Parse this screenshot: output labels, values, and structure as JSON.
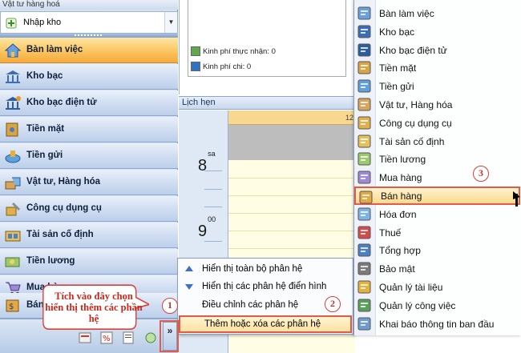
{
  "nav": {
    "section_title": "Vật tư hàng hoá",
    "combo_value": "Nhập kho",
    "items": [
      {
        "label": "Bàn làm việc",
        "icon": "home-icon",
        "selected": true
      },
      {
        "label": "Kho bạc",
        "icon": "bank-icon"
      },
      {
        "label": "Kho bạc điện tử",
        "icon": "e-treasury-icon"
      },
      {
        "label": "Tiền mặt",
        "icon": "cash-icon"
      },
      {
        "label": "Tiền gửi",
        "icon": "deposit-icon"
      },
      {
        "label": "Vật tư, Hàng hóa",
        "icon": "goods-icon"
      },
      {
        "label": "Công cụ dụng cụ",
        "icon": "tools-icon"
      },
      {
        "label": "Tài sản cố định",
        "icon": "fixed-asset-icon"
      },
      {
        "label": "Tiền lương",
        "icon": "salary-icon"
      },
      {
        "label": "Mua hàng",
        "icon": "cart-icon"
      },
      {
        "label": "Bán",
        "icon": "sales-icon"
      }
    ]
  },
  "panel": {
    "legend_received": "Kinh phí thực nhận: 0",
    "legend_spent": "Kinh phí chi: 0",
    "colors": {
      "received": "#5fa84a",
      "spent": "#2f72c4"
    }
  },
  "calendar": {
    "title": "Lịch hẹn",
    "day_header": "12",
    "hour_8": "8",
    "hour_8_suffix": "sa",
    "hour_9": "9",
    "hour_9_suffix": "00"
  },
  "context_menu": {
    "items": [
      {
        "label": "Hiển thị toàn bộ phân hệ",
        "icon": "arrow-up-icon"
      },
      {
        "label": "Hiển thị các phân hệ điển hình",
        "icon": "arrow-down-icon"
      },
      {
        "label": "Điều chỉnh các phân hệ",
        "icon": "none"
      },
      {
        "label": "Thêm hoặc xóa các phân hệ",
        "icon": "none",
        "highlighted": true
      }
    ]
  },
  "module_menu": {
    "items": [
      {
        "label": "Bàn làm việc",
        "icon": "home-icon"
      },
      {
        "label": "Kho bạc",
        "icon": "bank-icon"
      },
      {
        "label": "Kho bạc điện tử",
        "icon": "e-treasury-icon"
      },
      {
        "label": "Tiền mặt",
        "icon": "cash-icon"
      },
      {
        "label": "Tiền gửi",
        "icon": "deposit-icon"
      },
      {
        "label": "Vật tư, Hàng hóa",
        "icon": "goods-icon"
      },
      {
        "label": "Công cụ dụng cụ",
        "icon": "tools-icon"
      },
      {
        "label": "Tài sản cố định",
        "icon": "fixed-asset-icon"
      },
      {
        "label": "Tiền lương",
        "icon": "salary-icon"
      },
      {
        "label": "Mua hàng",
        "icon": "cart-icon"
      },
      {
        "label": "Bán hàng",
        "icon": "sales-icon",
        "highlighted": true
      },
      {
        "label": "Hóa đơn",
        "icon": "invoice-icon"
      },
      {
        "label": "Thuế",
        "icon": "tax-icon"
      },
      {
        "label": "Tổng hợp",
        "icon": "summary-icon"
      },
      {
        "label": "Bảo mật",
        "icon": "security-icon"
      },
      {
        "label": "Quản lý tài liệu",
        "icon": "documents-icon"
      },
      {
        "label": "Quản lý công việc",
        "icon": "tasks-icon"
      },
      {
        "label": "Khai báo thông tin ban đầu",
        "icon": "setup-icon"
      }
    ]
  },
  "annotations": {
    "callout_text": "Tích vào đây chọn hiển thị thêm các phần hệ",
    "badge_1": "1",
    "badge_2": "2",
    "badge_3": "3",
    "chevron": "»"
  }
}
